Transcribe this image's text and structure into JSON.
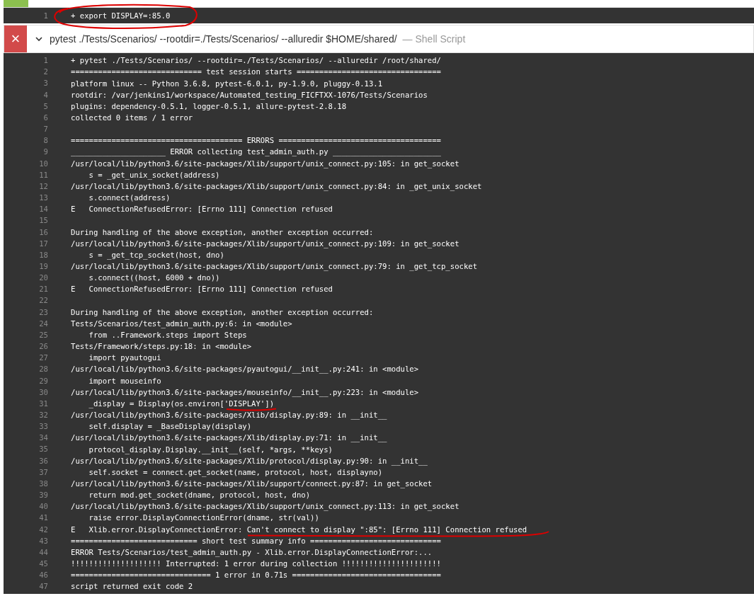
{
  "steps": [
    {
      "failed": false,
      "log": [
        {
          "number": "1",
          "text": "+ export DISPLAY=:85.0"
        }
      ]
    },
    {
      "failed": true,
      "icon": "×",
      "expanded": true,
      "title": "pytest ./Tests/Scenarios/ --rootdir=./Tests/Scenarios/ --alluredir $HOME/shared/",
      "subtitle": "— Shell Script",
      "log": [
        {
          "number": "1",
          "text": "+ pytest ./Tests/Scenarios/ --rootdir=./Tests/Scenarios/ --alluredir /root/shared/"
        },
        {
          "number": "2",
          "text": "============================= test session starts ================================"
        },
        {
          "number": "3",
          "text": "platform linux -- Python 3.6.8, pytest-6.0.1, py-1.9.0, pluggy-0.13.1"
        },
        {
          "number": "4",
          "text": "rootdir: /var/jenkins1/workspace/Automated_testing_FICFTXX-1076/Tests/Scenarios"
        },
        {
          "number": "5",
          "text": "plugins: dependency-0.5.1, logger-0.5.1, allure-pytest-2.8.18"
        },
        {
          "number": "6",
          "text": "collected 0 items / 1 error"
        },
        {
          "number": "7"
        },
        {
          "number": "8",
          "text": "====================================== ERRORS ===================================="
        },
        {
          "number": "9",
          "text": "_____________________ ERROR collecting test_admin_auth.py ________________________"
        },
        {
          "number": "10",
          "text": "/usr/local/lib/python3.6/site-packages/Xlib/support/unix_connect.py:105: in get_socket"
        },
        {
          "number": "11",
          "text": "    s = _get_unix_socket(address)"
        },
        {
          "number": "12",
          "text": "/usr/local/lib/python3.6/site-packages/Xlib/support/unix_connect.py:84: in _get_unix_socket"
        },
        {
          "number": "13",
          "text": "    s.connect(address)"
        },
        {
          "number": "14",
          "text": "E   ConnectionRefusedError: [Errno 111] Connection refused"
        },
        {
          "number": "15"
        },
        {
          "number": "16",
          "text": "During handling of the above exception, another exception occurred:"
        },
        {
          "number": "17",
          "text": "/usr/local/lib/python3.6/site-packages/Xlib/support/unix_connect.py:109: in get_socket"
        },
        {
          "number": "18",
          "text": "    s = _get_tcp_socket(host, dno)"
        },
        {
          "number": "19",
          "text": "/usr/local/lib/python3.6/site-packages/Xlib/support/unix_connect.py:79: in _get_tcp_socket"
        },
        {
          "number": "20",
          "text": "    s.connect((host, 6000 + dno))"
        },
        {
          "number": "21",
          "text": "E   ConnectionRefusedError: [Errno 111] Connection refused"
        },
        {
          "number": "22"
        },
        {
          "number": "23",
          "text": "During handling of the above exception, another exception occurred:"
        },
        {
          "number": "24",
          "text": "Tests/Scenarios/test_admin_auth.py:6: in <module>"
        },
        {
          "number": "25",
          "text": "    from ..Framework.steps import Steps"
        },
        {
          "number": "26",
          "text": "Tests/Framework/steps.py:18: in <module>"
        },
        {
          "number": "27",
          "text": "    import pyautogui"
        },
        {
          "number": "28",
          "text": "/usr/local/lib/python3.6/site-packages/pyautogui/__init__.py:241: in <module>"
        },
        {
          "number": "29",
          "text": "    import mouseinfo"
        },
        {
          "number": "30",
          "text": "/usr/local/lib/python3.6/site-packages/mouseinfo/__init__.py:223: in <module>"
        },
        {
          "number": "31",
          "text": "    _display = Display(os.environ['DISPLAY'])"
        },
        {
          "number": "32",
          "text": "/usr/local/lib/python3.6/site-packages/Xlib/display.py:89: in __init__"
        },
        {
          "number": "33",
          "text": "    self.display = _BaseDisplay(display)"
        },
        {
          "number": "34",
          "text": "/usr/local/lib/python3.6/site-packages/Xlib/display.py:71: in __init__"
        },
        {
          "number": "35",
          "text": "    protocol_display.Display.__init__(self, *args, **keys)"
        },
        {
          "number": "36",
          "text": "/usr/local/lib/python3.6/site-packages/Xlib/protocol/display.py:90: in __init__"
        },
        {
          "number": "37",
          "text": "    self.socket = connect.get_socket(name, protocol, host, displayno)"
        },
        {
          "number": "38",
          "text": "/usr/local/lib/python3.6/site-packages/Xlib/support/connect.py:87: in get_socket"
        },
        {
          "number": "39",
          "text": "    return mod.get_socket(dname, protocol, host, dno)"
        },
        {
          "number": "40",
          "text": "/usr/local/lib/python3.6/site-packages/Xlib/support/unix_connect.py:113: in get_socket"
        },
        {
          "number": "41",
          "text": "    raise error.DisplayConnectionError(dname, str(val))"
        },
        {
          "number": "42",
          "text": "E   Xlib.error.DisplayConnectionError: Can't connect to display \":85\": [Errno 111] Connection refused"
        },
        {
          "number": "43",
          "text": "============================ short test summary info ============================="
        },
        {
          "number": "44",
          "text": "ERROR Tests/Scenarios/test_admin_auth.py - Xlib.error.DisplayConnectionError:..."
        },
        {
          "number": "45",
          "text": "!!!!!!!!!!!!!!!!!!!! Interrupted: 1 error during collection !!!!!!!!!!!!!!!!!!!!!!"
        },
        {
          "number": "46",
          "text": "=============================== 1 error in 0.71s ================================="
        },
        {
          "number": "47",
          "text": "script returned exit code 2"
        }
      ]
    }
  ]
}
